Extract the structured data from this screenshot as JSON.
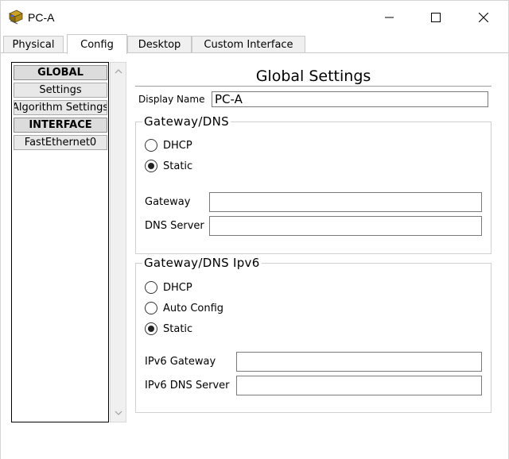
{
  "window": {
    "title": "PC-A",
    "icon": "pc-app-icon"
  },
  "tabs": [
    {
      "label": "Physical",
      "active": false
    },
    {
      "label": "Config",
      "active": true
    },
    {
      "label": "Desktop",
      "active": false
    },
    {
      "label": "Custom Interface",
      "active": false
    }
  ],
  "sidebar": {
    "items": [
      {
        "label": "GLOBAL",
        "type": "header"
      },
      {
        "label": "Settings",
        "type": "item"
      },
      {
        "label": "Algorithm Settings",
        "type": "item"
      },
      {
        "label": "INTERFACE",
        "type": "header"
      },
      {
        "label": "FastEthernet0",
        "type": "item"
      }
    ]
  },
  "main": {
    "title": "Global Settings",
    "display_name": {
      "label": "Display Name",
      "value": "PC-A"
    },
    "gateway_dns": {
      "legend": "Gateway/DNS",
      "radios": [
        {
          "label": "DHCP",
          "checked": false
        },
        {
          "label": "Static",
          "checked": true
        }
      ],
      "gateway": {
        "label": "Gateway",
        "value": ""
      },
      "dns_server": {
        "label": "DNS Server",
        "value": ""
      }
    },
    "gateway_dns_ipv6": {
      "legend": "Gateway/DNS Ipv6",
      "radios": [
        {
          "label": "DHCP",
          "checked": false
        },
        {
          "label": "Auto Config",
          "checked": false
        },
        {
          "label": "Static",
          "checked": true
        }
      ],
      "ipv6_gateway": {
        "label": "IPv6 Gateway",
        "value": ""
      },
      "ipv6_dns_server": {
        "label": "IPv6 DNS Server",
        "value": ""
      }
    }
  }
}
